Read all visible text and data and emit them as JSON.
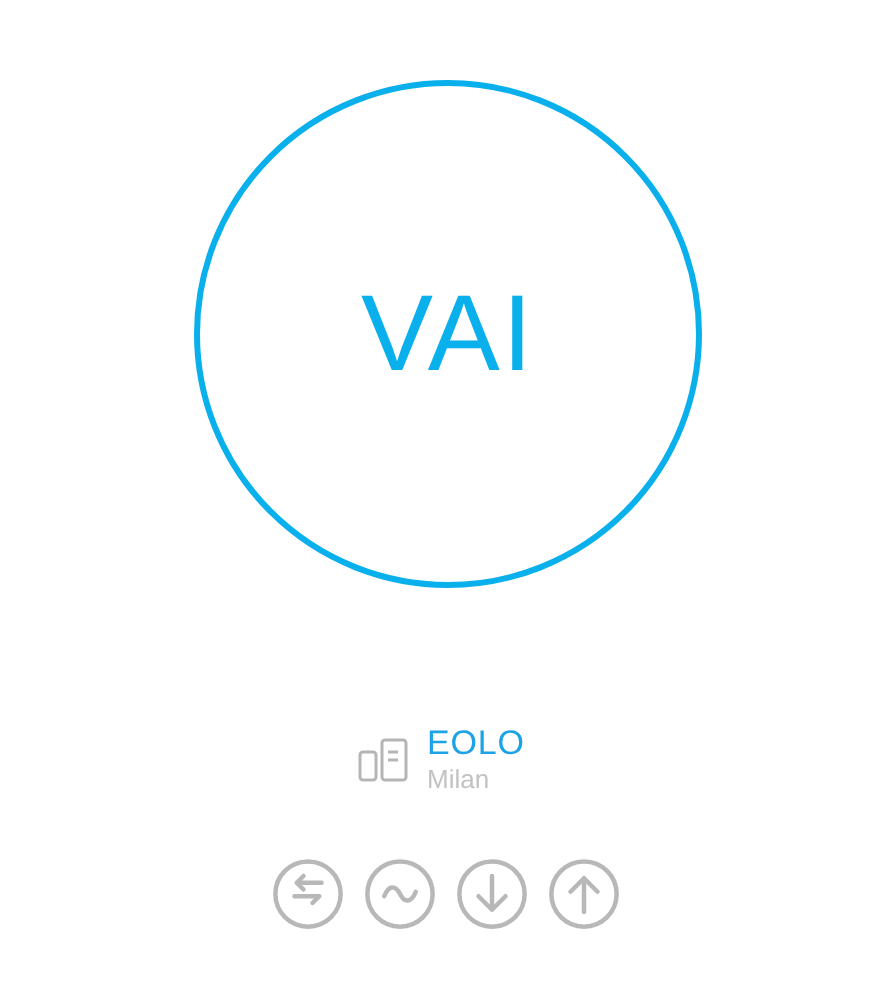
{
  "start_button": {
    "label": "VAI"
  },
  "server": {
    "name": "EOLO",
    "location": "Milan"
  },
  "actions": [
    {
      "kind": "swap"
    },
    {
      "kind": "wave"
    },
    {
      "kind": "download"
    },
    {
      "kind": "upload"
    }
  ]
}
